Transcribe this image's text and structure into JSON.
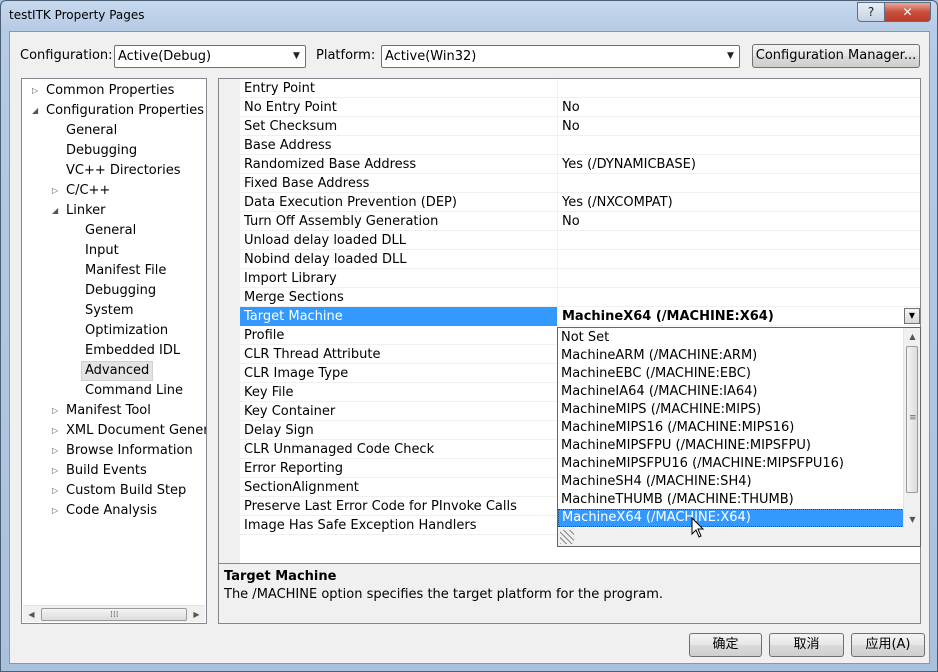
{
  "window": {
    "title": "testITK Property Pages",
    "help_glyph": "?",
    "close_glyph": "✕"
  },
  "toolbar": {
    "configuration_label": "Configuration:",
    "configuration_value": "Active(Debug)",
    "platform_label": "Platform:",
    "platform_value": "Active(Win32)",
    "config_manager_label": "Configuration Manager..."
  },
  "tree": {
    "items": [
      {
        "label": "Common Properties",
        "twisty": "▷"
      },
      {
        "label": "Configuration Properties",
        "twisty": "◢"
      },
      {
        "label": "General"
      },
      {
        "label": "Debugging"
      },
      {
        "label": "VC++ Directories"
      },
      {
        "label": "C/C++",
        "twisty": "▷"
      },
      {
        "label": "Linker",
        "twisty": "◢"
      },
      {
        "label": "General"
      },
      {
        "label": "Input"
      },
      {
        "label": "Manifest File"
      },
      {
        "label": "Debugging"
      },
      {
        "label": "System"
      },
      {
        "label": "Optimization"
      },
      {
        "label": "Embedded IDL"
      },
      {
        "label": "Advanced"
      },
      {
        "label": "Command Line"
      },
      {
        "label": "Manifest Tool",
        "twisty": "▷"
      },
      {
        "label": "XML Document Generat",
        "twisty": "▷"
      },
      {
        "label": "Browse Information",
        "twisty": "▷"
      },
      {
        "label": "Build Events",
        "twisty": "▷"
      },
      {
        "label": "Custom Build Step",
        "twisty": "▷"
      },
      {
        "label": "Code Analysis",
        "twisty": "▷"
      }
    ],
    "selected": "Advanced"
  },
  "properties": [
    {
      "name": "Entry Point",
      "value": ""
    },
    {
      "name": "No Entry Point",
      "value": "No"
    },
    {
      "name": "Set Checksum",
      "value": "No"
    },
    {
      "name": "Base Address",
      "value": ""
    },
    {
      "name": "Randomized Base Address",
      "value": "Yes (/DYNAMICBASE)"
    },
    {
      "name": "Fixed Base Address",
      "value": ""
    },
    {
      "name": "Data Execution Prevention (DEP)",
      "value": "Yes (/NXCOMPAT)"
    },
    {
      "name": "Turn Off Assembly Generation",
      "value": "No"
    },
    {
      "name": "Unload delay loaded DLL",
      "value": ""
    },
    {
      "name": "Nobind delay loaded DLL",
      "value": ""
    },
    {
      "name": "Import Library",
      "value": ""
    },
    {
      "name": "Merge Sections",
      "value": ""
    },
    {
      "name": "Target Machine",
      "value": "MachineX64 (/MACHINE:X64)"
    },
    {
      "name": "Profile",
      "value": ""
    },
    {
      "name": "CLR Thread Attribute",
      "value": ""
    },
    {
      "name": "CLR Image Type",
      "value": ""
    },
    {
      "name": "Key File",
      "value": ""
    },
    {
      "name": "Key Container",
      "value": ""
    },
    {
      "name": "Delay Sign",
      "value": ""
    },
    {
      "name": "CLR Unmanaged Code Check",
      "value": ""
    },
    {
      "name": "Error Reporting",
      "value": ""
    },
    {
      "name": "SectionAlignment",
      "value": ""
    },
    {
      "name": "Preserve Last Error Code for PInvoke Calls",
      "value": ""
    },
    {
      "name": "Image Has Safe Exception Handlers",
      "value": ""
    }
  ],
  "dropdown": {
    "options": [
      "Not Set",
      "MachineARM (/MACHINE:ARM)",
      "MachineEBC (/MACHINE:EBC)",
      "MachineIA64 (/MACHINE:IA64)",
      "MachineMIPS (/MACHINE:MIPS)",
      "MachineMIPS16 (/MACHINE:MIPS16)",
      "MachineMIPSFPU (/MACHINE:MIPSFPU)",
      "MachineMIPSFPU16 (/MACHINE:MIPSFPU16)",
      "MachineSH4 (/MACHINE:SH4)",
      "MachineTHUMB (/MACHINE:THUMB)",
      "MachineX64 (/MACHINE:X64)"
    ],
    "highlighted": "MachineX64 (/MACHINE:X64)"
  },
  "description": {
    "title": "Target Machine",
    "text": "The /MACHINE option specifies the target platform for the program."
  },
  "buttons": {
    "ok": "确定",
    "cancel": "取消",
    "apply": "应用(A)"
  },
  "colors": {
    "selection": "#3399ff",
    "window_frame": "#aac1dd",
    "client": "#f0f0f0"
  }
}
